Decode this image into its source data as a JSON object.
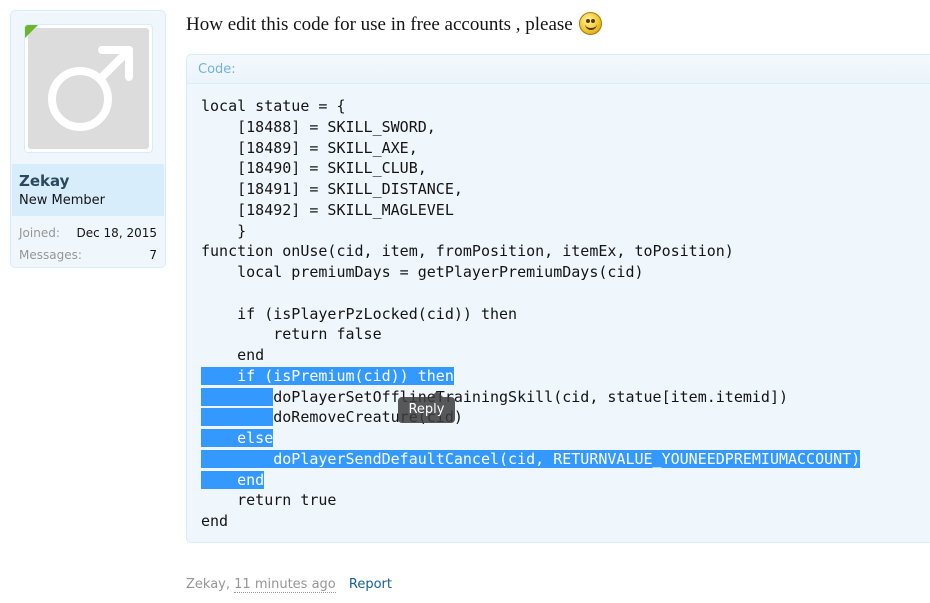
{
  "user": {
    "name": "Zekay",
    "title": "New Member",
    "joined_label": "Joined:",
    "joined_value": "Dec 18, 2015",
    "messages_label": "Messages:",
    "messages_value": "7",
    "avatar_icon": "male-symbol-icon"
  },
  "message": {
    "text": "How edit this code for use in free accounts , please",
    "smilie_icon": "smile-icon"
  },
  "code": {
    "label": "Code:",
    "lines": [
      "local statue = {",
      "    [18488] = SKILL_SWORD,",
      "    [18489] = SKILL_AXE,",
      "    [18490] = SKILL_CLUB,",
      "    [18491] = SKILL_DISTANCE,",
      "    [18492] = SKILL_MAGLEVEL",
      "    }",
      "function onUse(cid, item, fromPosition, itemEx, toPosition)",
      "    local premiumDays = getPlayerPremiumDays(cid)",
      "",
      "    if (isPlayerPzLocked(cid)) then",
      "        return false",
      "    end",
      "    if (isPremium(cid)) then",
      "        doPlayerSetOfflineTrainingSkill(cid, statue[item.itemid])",
      "        doRemoveCreature(cid)",
      "    else",
      "        doPlayerSendDefaultCancel(cid, RETURNVALUE_YOUNEEDPREMIUMACCOUNT)",
      "    end",
      "    return true",
      "end"
    ],
    "highlight_color": "#3399ff"
  },
  "tooltip": {
    "reply_label": "Reply"
  },
  "footer": {
    "author": "Zekay,",
    "time": "11 minutes ago",
    "report_label": "Report"
  }
}
